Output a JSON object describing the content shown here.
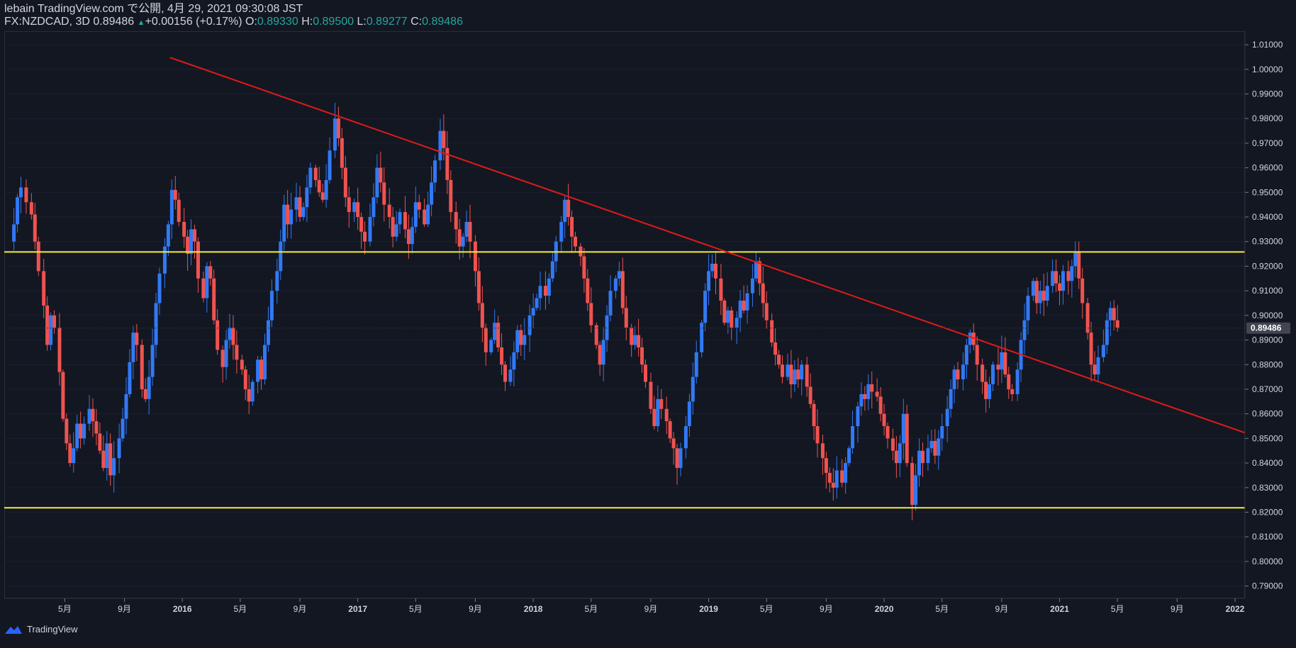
{
  "header": {
    "line1": "lebain TradingView.com で公開, 4月 29, 2021 09:30:08 JST",
    "symbol": "FX:NZDCAD, 3D",
    "last": "0.89486",
    "up_arrow": "▲",
    "change": "+0.00156 (+0.17%)",
    "o_label": "O:",
    "o_value": "0.89330",
    "h_label": "H:",
    "h_value": "0.89500",
    "l_label": "L:",
    "l_value": "0.89277",
    "c_label": "C:",
    "c_value": "0.89486"
  },
  "footer": {
    "brand": "TradingView"
  },
  "colors": {
    "background": "#131722",
    "bull": "#3179f5",
    "bear": "#ef5350",
    "trendline": "#e01a1a",
    "hline": "#f5eb3b",
    "price_tag": "#434651"
  },
  "chart_data": {
    "type": "candlestick",
    "symbol": "FX:NZDCAD",
    "interval": "3D",
    "ylim": [
      0.785,
      1.0155
    ],
    "y_ticks": [
      "1.01000",
      "1.00000",
      "0.99000",
      "0.98000",
      "0.97000",
      "0.96000",
      "0.95000",
      "0.94000",
      "0.93000",
      "0.92000",
      "0.91000",
      "0.90000",
      "0.89000",
      "0.88000",
      "0.87000",
      "0.86000",
      "0.85000",
      "0.84000",
      "0.83000",
      "0.82000",
      "0.81000",
      "0.80000",
      "0.79000"
    ],
    "x_ticks": [
      "5月",
      "9月",
      "2016",
      "5月",
      "9月",
      "2017",
      "5月",
      "9月",
      "2018",
      "5月",
      "9月",
      "2019",
      "5月",
      "9月",
      "2020",
      "5月",
      "9月",
      "2021",
      "5月",
      "9月",
      "2022"
    ],
    "x_tick_times": [
      2015.33,
      2015.67,
      2016.0,
      2016.33,
      2016.67,
      2017.0,
      2017.33,
      2017.67,
      2018.0,
      2018.33,
      2018.67,
      2019.0,
      2019.33,
      2019.67,
      2020.0,
      2020.33,
      2020.67,
      2021.0,
      2021.33,
      2021.67,
      2022.0
    ],
    "last_price": "0.89486",
    "horizontal_lines": [
      0.9258,
      0.8218
    ],
    "trendline": {
      "start": [
        2015.93,
        1.0048
      ],
      "end": [
        2022.0,
        0.8537
      ]
    },
    "close_series": [
      [
        2015.02,
        0.93
      ],
      [
        2015.04,
        0.937
      ],
      [
        2015.06,
        0.948
      ],
      [
        2015.08,
        0.952
      ],
      [
        2015.11,
        0.946
      ],
      [
        2015.14,
        0.941
      ],
      [
        2015.16,
        0.93
      ],
      [
        2015.18,
        0.918
      ],
      [
        2015.21,
        0.904
      ],
      [
        2015.23,
        0.888
      ],
      [
        2015.25,
        0.9
      ],
      [
        2015.27,
        0.895
      ],
      [
        2015.3,
        0.877
      ],
      [
        2015.32,
        0.858
      ],
      [
        2015.34,
        0.848
      ],
      [
        2015.36,
        0.84
      ],
      [
        2015.38,
        0.846
      ],
      [
        2015.4,
        0.856
      ],
      [
        2015.42,
        0.85
      ],
      [
        2015.44,
        0.856
      ],
      [
        2015.47,
        0.862
      ],
      [
        2015.49,
        0.857
      ],
      [
        2015.51,
        0.852
      ],
      [
        2015.53,
        0.845
      ],
      [
        2015.55,
        0.838
      ],
      [
        2015.57,
        0.848
      ],
      [
        2015.59,
        0.835
      ],
      [
        2015.61,
        0.842
      ],
      [
        2015.64,
        0.85
      ],
      [
        2015.66,
        0.858
      ],
      [
        2015.68,
        0.868
      ],
      [
        2015.7,
        0.881
      ],
      [
        2015.72,
        0.893
      ],
      [
        2015.74,
        0.888
      ],
      [
        2015.77,
        0.87
      ],
      [
        2015.79,
        0.866
      ],
      [
        2015.81,
        0.875
      ],
      [
        2015.83,
        0.888
      ],
      [
        2015.85,
        0.905
      ],
      [
        2015.87,
        0.917
      ],
      [
        2015.9,
        0.928
      ],
      [
        2015.92,
        0.937
      ],
      [
        2015.94,
        0.951
      ],
      [
        2015.96,
        0.947
      ],
      [
        2015.98,
        0.938
      ],
      [
        2016.01,
        0.932
      ],
      [
        2016.03,
        0.925
      ],
      [
        2016.05,
        0.935
      ],
      [
        2016.07,
        0.93
      ],
      [
        2016.09,
        0.915
      ],
      [
        2016.12,
        0.907
      ],
      [
        2016.14,
        0.92
      ],
      [
        2016.16,
        0.915
      ],
      [
        2016.18,
        0.898
      ],
      [
        2016.2,
        0.886
      ],
      [
        2016.23,
        0.879
      ],
      [
        2016.25,
        0.89
      ],
      [
        2016.27,
        0.895
      ],
      [
        2016.29,
        0.888
      ],
      [
        2016.31,
        0.882
      ],
      [
        2016.34,
        0.878
      ],
      [
        2016.36,
        0.87
      ],
      [
        2016.38,
        0.865
      ],
      [
        2016.4,
        0.873
      ],
      [
        2016.43,
        0.882
      ],
      [
        2016.45,
        0.874
      ],
      [
        2016.47,
        0.888
      ],
      [
        2016.49,
        0.898
      ],
      [
        2016.51,
        0.91
      ],
      [
        2016.54,
        0.918
      ],
      [
        2016.56,
        0.93
      ],
      [
        2016.58,
        0.945
      ],
      [
        2016.6,
        0.937
      ],
      [
        2016.62,
        0.943
      ],
      [
        2016.65,
        0.948
      ],
      [
        2016.67,
        0.94
      ],
      [
        2016.69,
        0.944
      ],
      [
        2016.71,
        0.952
      ],
      [
        2016.73,
        0.96
      ],
      [
        2016.76,
        0.955
      ],
      [
        2016.78,
        0.95
      ],
      [
        2016.8,
        0.947
      ],
      [
        2016.82,
        0.955
      ],
      [
        2016.84,
        0.967
      ],
      [
        2016.87,
        0.98
      ],
      [
        2016.89,
        0.972
      ],
      [
        2016.91,
        0.96
      ],
      [
        2016.93,
        0.948
      ],
      [
        2016.95,
        0.942
      ],
      [
        2016.98,
        0.946
      ],
      [
        2017.0,
        0.94
      ],
      [
        2017.02,
        0.934
      ],
      [
        2017.04,
        0.93
      ],
      [
        2017.07,
        0.94
      ],
      [
        2017.09,
        0.948
      ],
      [
        2017.11,
        0.96
      ],
      [
        2017.13,
        0.954
      ],
      [
        2017.15,
        0.945
      ],
      [
        2017.18,
        0.94
      ],
      [
        2017.2,
        0.932
      ],
      [
        2017.22,
        0.937
      ],
      [
        2017.24,
        0.942
      ],
      [
        2017.27,
        0.935
      ],
      [
        2017.29,
        0.929
      ],
      [
        2017.31,
        0.936
      ],
      [
        2017.33,
        0.946
      ],
      [
        2017.35,
        0.943
      ],
      [
        2017.38,
        0.937
      ],
      [
        2017.4,
        0.945
      ],
      [
        2017.42,
        0.954
      ],
      [
        2017.44,
        0.963
      ],
      [
        2017.47,
        0.975
      ],
      [
        2017.49,
        0.968
      ],
      [
        2017.51,
        0.955
      ],
      [
        2017.53,
        0.942
      ],
      [
        2017.56,
        0.935
      ],
      [
        2017.58,
        0.928
      ],
      [
        2017.6,
        0.932
      ],
      [
        2017.62,
        0.938
      ],
      [
        2017.64,
        0.93
      ],
      [
        2017.67,
        0.918
      ],
      [
        2017.69,
        0.905
      ],
      [
        2017.71,
        0.895
      ],
      [
        2017.73,
        0.885
      ],
      [
        2017.76,
        0.89
      ],
      [
        2017.78,
        0.897
      ],
      [
        2017.8,
        0.887
      ],
      [
        2017.82,
        0.88
      ],
      [
        2017.84,
        0.873
      ],
      [
        2017.87,
        0.878
      ],
      [
        2017.89,
        0.885
      ],
      [
        2017.91,
        0.894
      ],
      [
        2017.93,
        0.888
      ],
      [
        2017.95,
        0.892
      ],
      [
        2017.98,
        0.9
      ],
      [
        2018.0,
        0.903
      ],
      [
        2018.02,
        0.907
      ],
      [
        2018.04,
        0.912
      ],
      [
        2018.07,
        0.908
      ],
      [
        2018.09,
        0.915
      ],
      [
        2018.11,
        0.922
      ],
      [
        2018.13,
        0.93
      ],
      [
        2018.16,
        0.938
      ],
      [
        2018.18,
        0.947
      ],
      [
        2018.2,
        0.94
      ],
      [
        2018.22,
        0.932
      ],
      [
        2018.24,
        0.928
      ],
      [
        2018.27,
        0.924
      ],
      [
        2018.29,
        0.915
      ],
      [
        2018.31,
        0.905
      ],
      [
        2018.33,
        0.896
      ],
      [
        2018.36,
        0.888
      ],
      [
        2018.38,
        0.88
      ],
      [
        2018.4,
        0.89
      ],
      [
        2018.42,
        0.9
      ],
      [
        2018.44,
        0.91
      ],
      [
        2018.47,
        0.915
      ],
      [
        2018.49,
        0.918
      ],
      [
        2018.51,
        0.903
      ],
      [
        2018.53,
        0.895
      ],
      [
        2018.56,
        0.888
      ],
      [
        2018.58,
        0.892
      ],
      [
        2018.6,
        0.887
      ],
      [
        2018.62,
        0.88
      ],
      [
        2018.64,
        0.873
      ],
      [
        2018.67,
        0.862
      ],
      [
        2018.69,
        0.855
      ],
      [
        2018.71,
        0.866
      ],
      [
        2018.73,
        0.862
      ],
      [
        2018.76,
        0.857
      ],
      [
        2018.78,
        0.85
      ],
      [
        2018.8,
        0.846
      ],
      [
        2018.82,
        0.838
      ],
      [
        2018.84,
        0.846
      ],
      [
        2018.87,
        0.855
      ],
      [
        2018.89,
        0.865
      ],
      [
        2018.91,
        0.875
      ],
      [
        2018.93,
        0.885
      ],
      [
        2018.96,
        0.897
      ],
      [
        2018.98,
        0.91
      ],
      [
        2019.0,
        0.918
      ],
      [
        2019.02,
        0.921
      ],
      [
        2019.04,
        0.915
      ],
      [
        2019.07,
        0.906
      ],
      [
        2019.09,
        0.897
      ],
      [
        2019.11,
        0.902
      ],
      [
        2019.13,
        0.895
      ],
      [
        2019.16,
        0.899
      ],
      [
        2019.18,
        0.906
      ],
      [
        2019.2,
        0.902
      ],
      [
        2019.22,
        0.909
      ],
      [
        2019.25,
        0.915
      ],
      [
        2019.27,
        0.922
      ],
      [
        2019.29,
        0.913
      ],
      [
        2019.31,
        0.905
      ],
      [
        2019.33,
        0.898
      ],
      [
        2019.36,
        0.889
      ],
      [
        2019.38,
        0.884
      ],
      [
        2019.4,
        0.88
      ],
      [
        2019.42,
        0.875
      ],
      [
        2019.45,
        0.88
      ],
      [
        2019.47,
        0.872
      ],
      [
        2019.49,
        0.878
      ],
      [
        2019.51,
        0.874
      ],
      [
        2019.53,
        0.88
      ],
      [
        2019.56,
        0.871
      ],
      [
        2019.58,
        0.864
      ],
      [
        2019.6,
        0.855
      ],
      [
        2019.62,
        0.848
      ],
      [
        2019.65,
        0.842
      ],
      [
        2019.67,
        0.836
      ],
      [
        2019.69,
        0.832
      ],
      [
        2019.71,
        0.83
      ],
      [
        2019.73,
        0.837
      ],
      [
        2019.76,
        0.832
      ],
      [
        2019.78,
        0.84
      ],
      [
        2019.8,
        0.846
      ],
      [
        2019.82,
        0.855
      ],
      [
        2019.85,
        0.863
      ],
      [
        2019.87,
        0.868
      ],
      [
        2019.89,
        0.866
      ],
      [
        2019.91,
        0.872
      ],
      [
        2019.93,
        0.869
      ],
      [
        2019.96,
        0.867
      ],
      [
        2019.98,
        0.86
      ],
      [
        2020.0,
        0.855
      ],
      [
        2020.02,
        0.85
      ],
      [
        2020.05,
        0.845
      ],
      [
        2020.07,
        0.84
      ],
      [
        2020.09,
        0.848
      ],
      [
        2020.11,
        0.86
      ],
      [
        2020.13,
        0.84
      ],
      [
        2020.16,
        0.823
      ],
      [
        2020.18,
        0.835
      ],
      [
        2020.2,
        0.845
      ],
      [
        2020.22,
        0.84
      ],
      [
        2020.25,
        0.846
      ],
      [
        2020.27,
        0.849
      ],
      [
        2020.29,
        0.843
      ],
      [
        2020.31,
        0.85
      ],
      [
        2020.33,
        0.855
      ],
      [
        2020.36,
        0.862
      ],
      [
        2020.38,
        0.87
      ],
      [
        2020.4,
        0.878
      ],
      [
        2020.42,
        0.874
      ],
      [
        2020.45,
        0.88
      ],
      [
        2020.47,
        0.888
      ],
      [
        2020.49,
        0.893
      ],
      [
        2020.51,
        0.888
      ],
      [
        2020.53,
        0.88
      ],
      [
        2020.56,
        0.873
      ],
      [
        2020.58,
        0.866
      ],
      [
        2020.6,
        0.872
      ],
      [
        2020.62,
        0.88
      ],
      [
        2020.65,
        0.878
      ],
      [
        2020.67,
        0.885
      ],
      [
        2020.69,
        0.876
      ],
      [
        2020.71,
        0.87
      ],
      [
        2020.73,
        0.868
      ],
      [
        2020.76,
        0.878
      ],
      [
        2020.78,
        0.89
      ],
      [
        2020.8,
        0.898
      ],
      [
        2020.82,
        0.908
      ],
      [
        2020.85,
        0.914
      ],
      [
        2020.87,
        0.905
      ],
      [
        2020.89,
        0.91
      ],
      [
        2020.91,
        0.906
      ],
      [
        2020.93,
        0.912
      ],
      [
        2020.96,
        0.918
      ],
      [
        2020.98,
        0.913
      ],
      [
        2021.0,
        0.91
      ],
      [
        2021.02,
        0.918
      ],
      [
        2021.05,
        0.914
      ],
      [
        2021.07,
        0.92
      ],
      [
        2021.09,
        0.926
      ],
      [
        2021.11,
        0.915
      ],
      [
        2021.13,
        0.905
      ],
      [
        2021.16,
        0.893
      ],
      [
        2021.18,
        0.88
      ],
      [
        2021.2,
        0.876
      ],
      [
        2021.22,
        0.883
      ],
      [
        2021.25,
        0.888
      ],
      [
        2021.27,
        0.898
      ],
      [
        2021.29,
        0.903
      ],
      [
        2021.31,
        0.898
      ],
      [
        2021.33,
        0.895
      ]
    ]
  }
}
